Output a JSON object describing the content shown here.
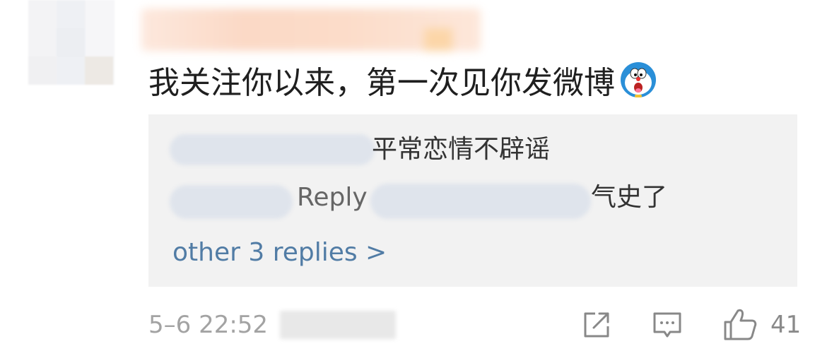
{
  "comment": {
    "text": "我关注你以来，第一次见你发微博"
  },
  "replies": [
    {
      "text": "平常恋情不辟谣"
    },
    {
      "label": "Reply",
      "text": "气史了"
    }
  ],
  "more_replies": "other 3 replies >",
  "footer": {
    "timestamp": "5–6 22:52",
    "like_count": "41"
  },
  "icons": [
    "share-icon",
    "comment-icon",
    "like-icon"
  ],
  "colors": {
    "link": "#517ca5",
    "reply_bg": "#f2f2f2",
    "meta": "#a3a3a3"
  }
}
